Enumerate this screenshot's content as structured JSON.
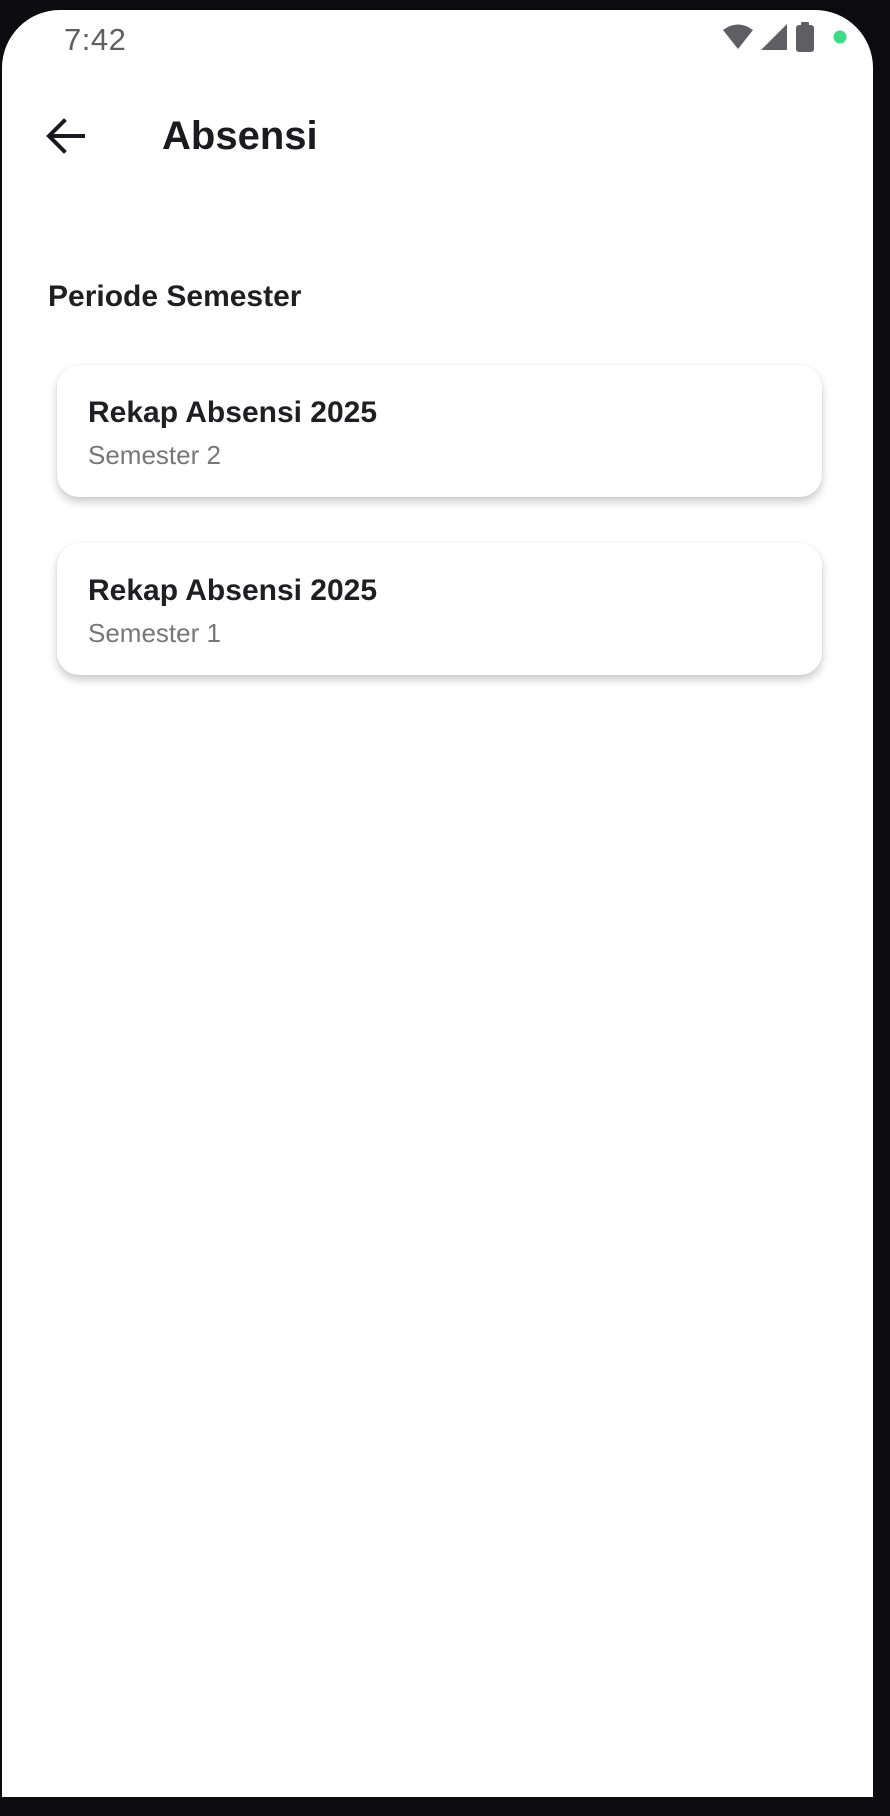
{
  "status_bar": {
    "time": "7:42",
    "icons": [
      "wifi-icon",
      "cellular-signal-icon",
      "battery-icon",
      "privacy-indicator-icon"
    ],
    "indicator_color": "#3ddc84"
  },
  "app_bar": {
    "back_icon": "arrow-left-icon",
    "title": "Absensi"
  },
  "section": {
    "heading": "Periode Semester"
  },
  "cards": [
    {
      "title": "Rekap Absensi 2025",
      "subtitle": "Semester 2"
    },
    {
      "title": "Rekap Absensi 2025",
      "subtitle": "Semester 1"
    }
  ],
  "colors": {
    "background": "#ffffff",
    "frame": "#0c0c0e",
    "text_primary": "#1f1f23",
    "text_secondary": "#77777b"
  }
}
